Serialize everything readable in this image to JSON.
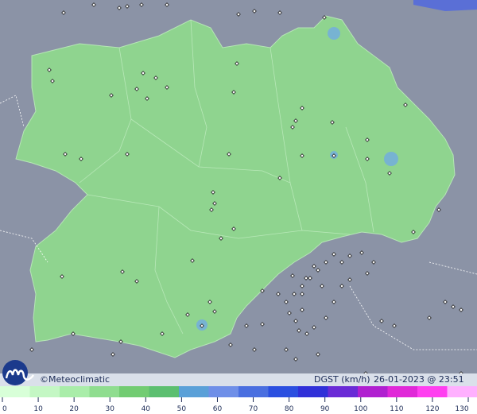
{
  "footer": {
    "credit": "©Meteoclimatic",
    "variable": "DGST (km/h)",
    "datetime": "26-01-2023 @ 23:51 UTC"
  },
  "logo": {
    "icon": "meteoclimatic-m-logo"
  },
  "scale": {
    "labels": [
      "0",
      "10",
      "20",
      "30",
      "40",
      "50",
      "60",
      "70",
      "80",
      "90",
      "100",
      "110",
      "120",
      "130"
    ],
    "colors": [
      "#d8ffd8",
      "#c4f7c4",
      "#a9eda9",
      "#8fdd8f",
      "#72cc72",
      "#5cbf70",
      "#5aa0d8",
      "#6f8fe8",
      "#4a6fe0",
      "#2b4fe0",
      "#3030d8",
      "#6a2bd6",
      "#b020d0",
      "#e028d8",
      "#ff3ff0",
      "#ffb0ff"
    ]
  },
  "map": {
    "region_color": "#8fd48f",
    "background_color": "#8b93a6",
    "station_marker": "diamond"
  }
}
